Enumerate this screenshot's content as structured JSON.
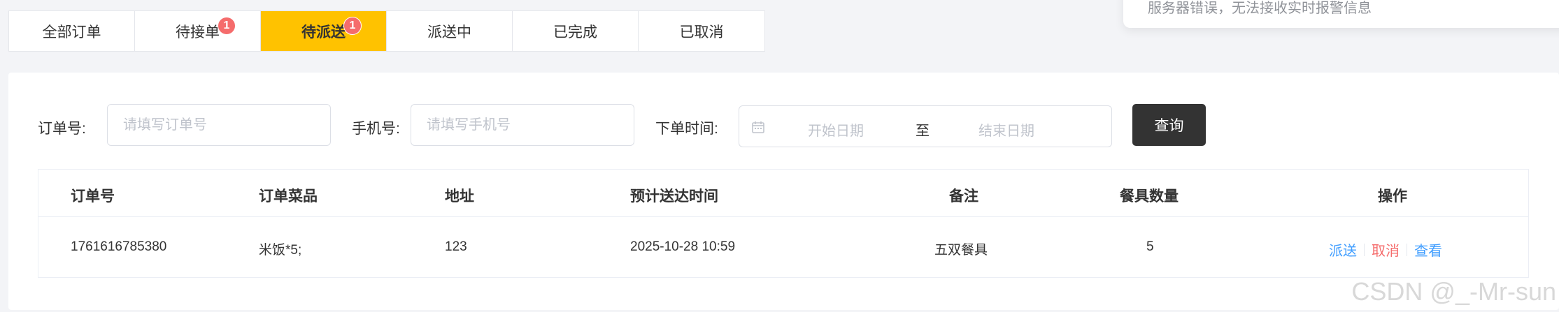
{
  "tabs": [
    {
      "label": "全部订单",
      "badge": null,
      "active": false
    },
    {
      "label": "待接单",
      "badge": "1",
      "active": false
    },
    {
      "label": "待派送",
      "badge": "1",
      "active": true
    },
    {
      "label": "派送中",
      "badge": null,
      "active": false
    },
    {
      "label": "已完成",
      "badge": null,
      "active": false
    },
    {
      "label": "已取消",
      "badge": null,
      "active": false
    }
  ],
  "toast": {
    "message": "服务器错误，无法接收实时报警信息"
  },
  "filters": {
    "order_no_label": "订单号:",
    "order_no_placeholder": "请填写订单号",
    "phone_label": "手机号:",
    "phone_placeholder": "请填写手机号",
    "time_label": "下单时间:",
    "date_start_placeholder": "开始日期",
    "date_separator": "至",
    "date_end_placeholder": "结束日期",
    "query_label": "查询"
  },
  "table": {
    "columns": [
      "订单号",
      "订单菜品",
      "地址",
      "预计送达时间",
      "备注",
      "餐具数量",
      "操作"
    ],
    "rows": [
      {
        "order_no": "1761616785380",
        "dishes": "米饭*5;",
        "address": "123",
        "eta": "2025-10-28 10:59",
        "remark": "五双餐具",
        "tableware": "5",
        "actions": [
          "派送",
          "取消",
          "查看"
        ]
      }
    ]
  },
  "watermark": "CSDN @_-Mr-sun",
  "colors": {
    "accent": "#ffc200",
    "badge": "#f56c6c",
    "link_blue": "#419eff",
    "link_red": "#f56c6c",
    "button_dark": "#333333"
  }
}
